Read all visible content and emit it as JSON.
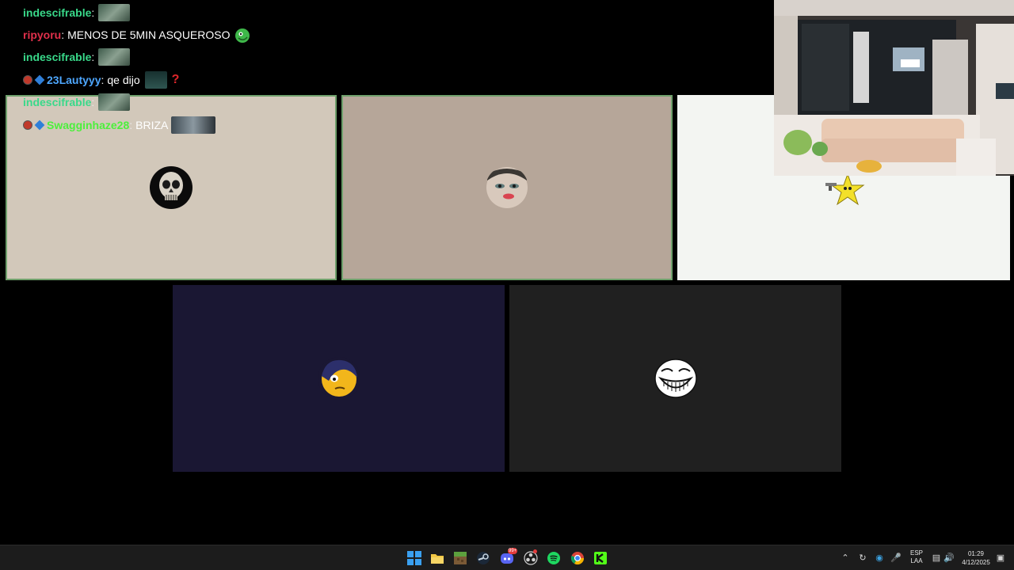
{
  "chat": {
    "messages": [
      {
        "user": "indescifrable",
        "text": "",
        "user_color": "#39d98a",
        "badges": [],
        "emotes": [
          "image-emote"
        ]
      },
      {
        "user": "ripyoru",
        "text": "MENOS DE 5MIN ASQUEROSO",
        "user_color": "#e0304b",
        "badges": [],
        "emotes": [
          "green-creature-emote"
        ]
      },
      {
        "user": "indescifrable",
        "text": "",
        "user_color": "#39d98a",
        "badges": [],
        "emotes": [
          "image-emote"
        ]
      },
      {
        "user": "23Lautyyy",
        "text": "qe dijo",
        "user_color": "#4ea7ff",
        "badges": [
          "red-badge",
          "blue-cube-badge"
        ],
        "emotes": [
          "dark-figure-emote",
          "red-question-emote"
        ]
      },
      {
        "user": "indescifrable",
        "text": "",
        "user_color": "#39d98a",
        "badges": [],
        "emotes": [
          "image-emote"
        ]
      },
      {
        "user": "Swagginhaze28",
        "text": "BRIZA",
        "user_color": "#4cf03c",
        "badges": [
          "red-badge",
          "blue-cube-badge"
        ],
        "emotes": [
          "photo-emote"
        ]
      }
    ]
  },
  "call": {
    "tiles": [
      {
        "name": "participant-skull",
        "bg": "#d2c8ba",
        "speaking": true,
        "avatar": "skull-avatar"
      },
      {
        "name": "participant-face",
        "bg": "#b6a699",
        "speaking": true,
        "avatar": "face-avatar"
      },
      {
        "name": "participant-star",
        "bg": "#f3f5f2",
        "speaking": false,
        "avatar": "star-avatar"
      },
      {
        "name": "participant-emo",
        "bg": "#1a1733",
        "speaking": false,
        "avatar": "emo-smiley-avatar"
      },
      {
        "name": "participant-troll",
        "bg": "#202020",
        "speaking": false,
        "avatar": "troll-face-avatar"
      }
    ]
  },
  "webcam": {
    "content": "living room with couch and plush toys"
  },
  "taskbar": {
    "apps": [
      "windows-start-icon",
      "file-explorer-icon",
      "minecraft-icon",
      "steam-icon",
      "discord-icon",
      "obs-icon",
      "spotify-icon",
      "chrome-icon",
      "kick-icon"
    ],
    "discord_badge": "99+",
    "tray": [
      "chevron-up-icon",
      "sync-icon",
      "shield-icon",
      "microphone-icon",
      "network-icon",
      "volume-icon",
      "notification-icon"
    ],
    "lang_line1": "ESP",
    "lang_line2": "LAA",
    "time": "01:29",
    "date": "4/12/2025"
  },
  "colors": {
    "accent_speaking": "#6fa06c",
    "taskbar_bg": "#1c1c1c"
  }
}
